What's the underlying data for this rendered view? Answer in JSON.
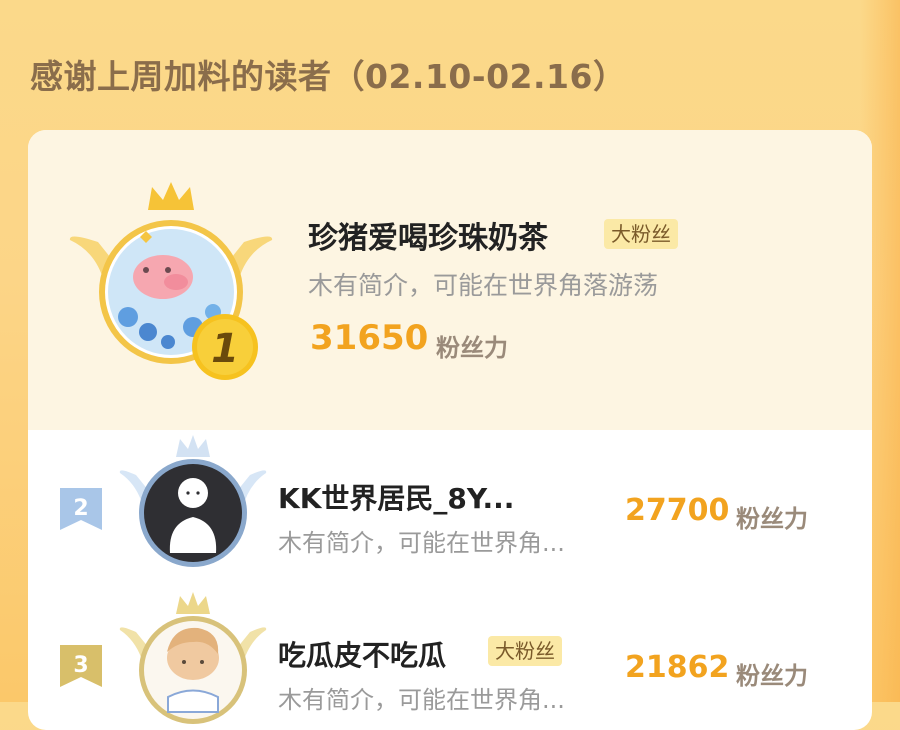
{
  "header": {
    "title": "感谢上周加料的读者（02.10-02.16）"
  },
  "colors": {
    "accent": "#f2a31f",
    "badge_bg": "#fbe9a6",
    "background": "#fcd587"
  },
  "first_place": {
    "rank": "1",
    "name": "珍猪爱喝珍珠奶茶",
    "badge": "大粉丝",
    "bio": "木有简介，可能在世界角落游荡",
    "score": "31650",
    "score_unit": "粉丝力"
  },
  "rankings": [
    {
      "rank": "2",
      "name": "KK世界居民_8Y...",
      "badge": "",
      "bio": "木有简介，可能在世界角...",
      "score": "27700",
      "score_unit": "粉丝力"
    },
    {
      "rank": "3",
      "name": "吃瓜皮不吃瓜",
      "badge": "大粉丝",
      "bio": "木有简介，可能在世界角...",
      "score": "21862",
      "score_unit": "粉丝力"
    }
  ]
}
